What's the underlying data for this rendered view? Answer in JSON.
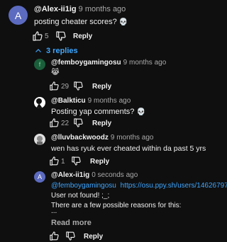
{
  "colors": {
    "bg": "#0f0f0f",
    "link": "#3ea6ff",
    "muted": "#aaaaaa",
    "text": "#f1f1f1"
  },
  "comment": {
    "avatar_letter": "A",
    "avatar_color": "#5c6bc0",
    "author": "@Alex-ii1ig",
    "time": "9 months ago",
    "text": "posting cheater scores?",
    "text_emoji": "💀",
    "likes": "5",
    "reply_label": "Reply",
    "icons": [
      "thumb-up-icon",
      "thumb-down-icon"
    ]
  },
  "replies_toggle": {
    "label": "3 replies",
    "icon": "chevron-up-icon"
  },
  "replies": [
    {
      "avatar_letter": "f",
      "avatar_color": "#1b5e3b",
      "author": "@femboygamingosu",
      "time": "9 months ago",
      "text": "😹",
      "likes": "29",
      "reply_label": "Reply"
    },
    {
      "avatar_color": "#ffffff",
      "author": "@Balkticu",
      "time": "9 months ago",
      "text": "Posting yap comments?",
      "text_emoji": "💀",
      "likes": "22",
      "reply_label": "Reply"
    },
    {
      "avatar_color": "#e0e0e0",
      "author": "@lluvbackwoodz",
      "time": "9 months ago",
      "text": "wen has ryuk ever cheated within da past 5 yrs",
      "likes": "1",
      "reply_label": "Reply"
    },
    {
      "avatar_letter": "A",
      "avatar_color": "#5c6bc0",
      "author": "@Alex-ii1ig",
      "time": "0 seconds ago",
      "mention": "@femboygamingosu",
      "link": "https://osu.ppy.sh/users/14626797",
      "line2": "User not found! ;_;",
      "line3": "There are a few possible reasons for this:",
      "line4": "...",
      "read_more": "Read more",
      "reply_label": "Reply"
    }
  ]
}
